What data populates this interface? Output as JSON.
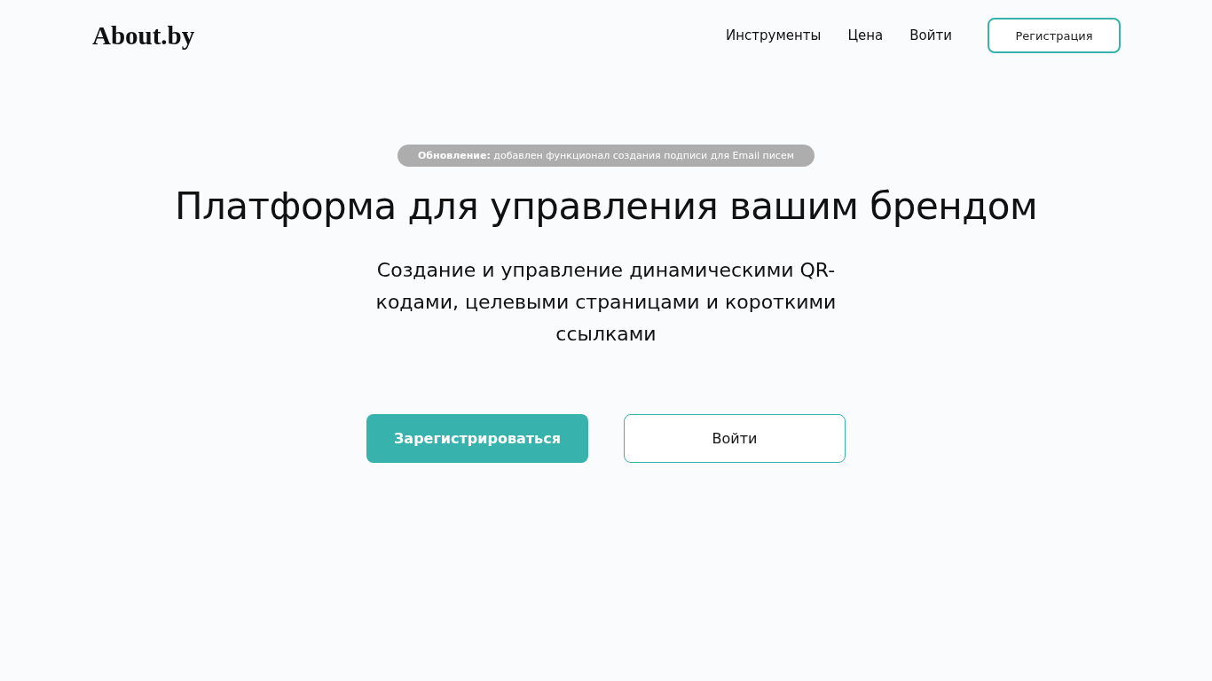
{
  "header": {
    "logo": "About.by",
    "nav": [
      "Инструменты",
      "Цена",
      "Войти"
    ],
    "register_button": "Регистрация"
  },
  "hero": {
    "announcement": "**Обновление:** добавлен функционал создания подписи для Email писем",
    "title": "Платформа для управления вашим брендом",
    "subtitle": "Создание и управление динамическими QR-кодами, целевыми страницами и короткими ссылками",
    "buttons": [
      {
        "label": "Зарегистрироваться",
        "kind": "primary"
      },
      {
        "label": "Войти",
        "kind": "outline"
      }
    ]
  }
}
